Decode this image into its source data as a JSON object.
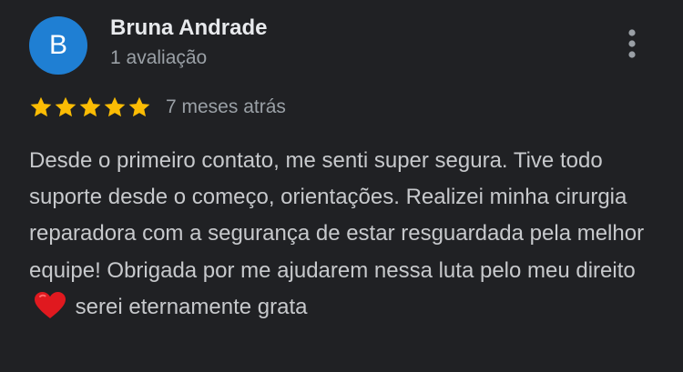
{
  "review": {
    "author": {
      "initial": "B",
      "name": "Bruna Andrade",
      "review_count": "1 avaliação",
      "avatar_color": "#1f7fd3"
    },
    "rating": 5,
    "rating_max": 5,
    "star_color": "#fbbc04",
    "timestamp": "7 meses atrás",
    "text_before_emoji": "Desde o primeiro contato, me senti super segura. Tive todo suporte desde o começo, orientações. Realizei minha cirurgia reparadora com a segurança de estar resguardada pela melhor equipe! Obrigada por me ajudarem nessa luta pelo meu direito",
    "emoji": "heart-icon",
    "text_after_emoji": "serei eternamente grata"
  },
  "menu": {
    "icon": "more-vertical-icon"
  }
}
